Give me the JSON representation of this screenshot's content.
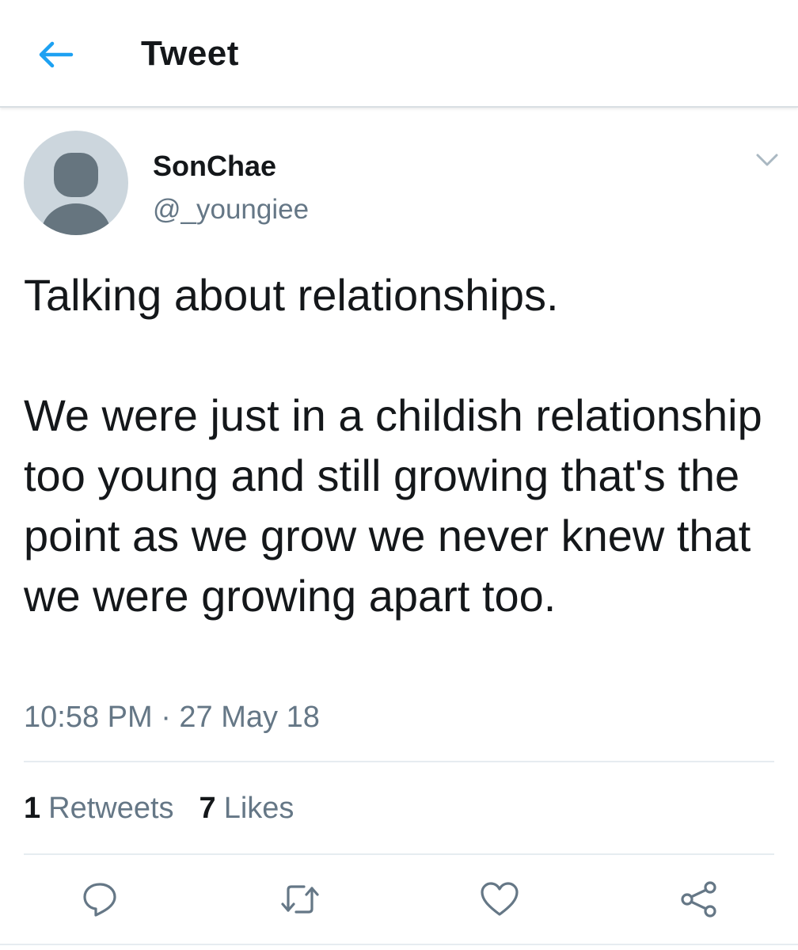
{
  "header": {
    "title": "Tweet",
    "back_icon": "arrow-left-icon",
    "accent_color": "#1da1f2"
  },
  "tweet": {
    "display_name": "SonChae",
    "handle": "@_youngiee",
    "paragraphs": [
      "Talking about relationships.",
      "We were just in a childish relationship too young and still growing that's the point as we grow we never knew that we were growing apart too."
    ],
    "timestamp": "10:58 PM · 27 May 18",
    "retweets_count": "1",
    "retweets_label": "Retweets",
    "likes_count": "7",
    "likes_label": "Likes"
  },
  "actions": [
    {
      "name": "reply",
      "icon": "reply-bubble-icon"
    },
    {
      "name": "retweet",
      "icon": "retweet-icon"
    },
    {
      "name": "like",
      "icon": "heart-icon"
    },
    {
      "name": "share",
      "icon": "share-icon"
    }
  ],
  "colors": {
    "text_primary": "#14171a",
    "text_secondary": "#657786",
    "icon_gray": "#657786",
    "divider": "#e6ecf0",
    "avatar_bg": "#ccd6dd",
    "avatar_figure": "#66757f"
  }
}
